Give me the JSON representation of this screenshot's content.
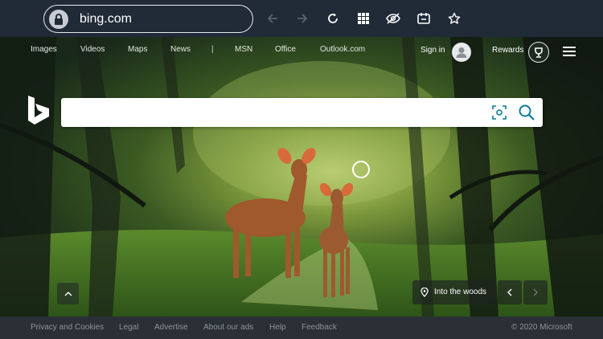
{
  "browser": {
    "url": "bing.com",
    "toolbar_icons": [
      "back-arrow-icon",
      "forward-arrow-icon",
      "reload-icon",
      "apps-grid-icon",
      "hide-eye-icon",
      "reader-icon",
      "favorite-star-icon"
    ]
  },
  "nav": {
    "links": [
      "Images",
      "Videos",
      "Maps",
      "News",
      "MSN",
      "Office",
      "Outlook.com"
    ],
    "separator": "|"
  },
  "account": {
    "signin_label": "Sign in",
    "rewards_label": "Rewards"
  },
  "search": {
    "value": "",
    "placeholder": ""
  },
  "image_caption": "Into the woods",
  "footer": {
    "links": [
      "Privacy and Cookies",
      "Legal",
      "Advertise",
      "About our ads",
      "Help",
      "Feedback"
    ],
    "copyright": "© 2020 Microsoft"
  },
  "colors": {
    "browser_bar": "#212b38",
    "footer": "#2a3036",
    "accent": "#0c7a9c"
  }
}
